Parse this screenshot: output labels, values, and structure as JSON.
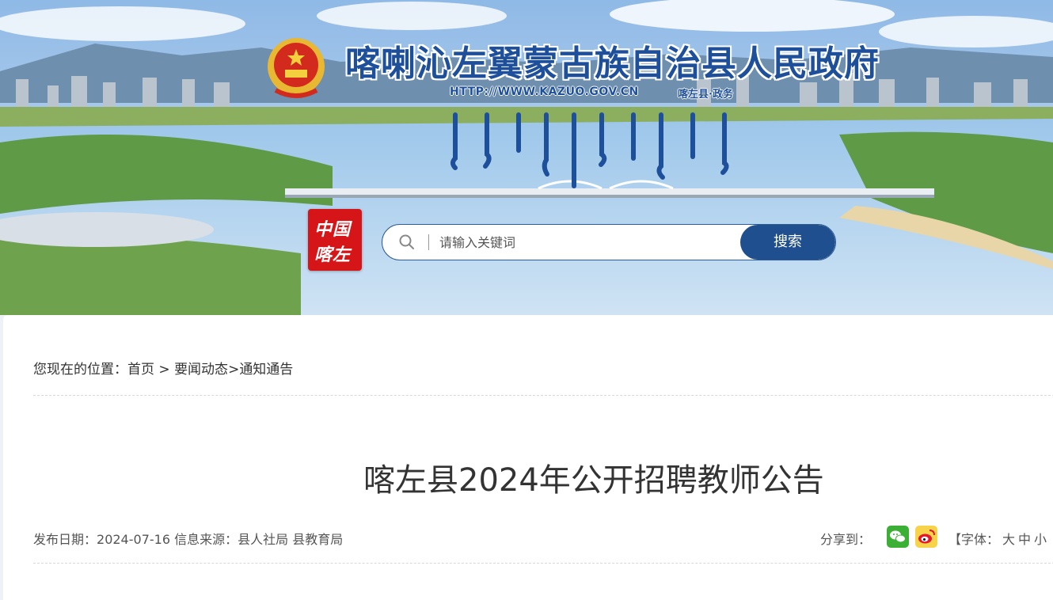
{
  "header": {
    "site_title": "喀喇沁左翼蒙古族自治县人民政府",
    "site_url": "HTTP://WWW.KAZUO.GOV.CN",
    "site_sub": "喀左县·政务",
    "logo_line1": "中国",
    "logo_line2": "喀左"
  },
  "search": {
    "placeholder": "请输入关键词",
    "button_label": "搜索"
  },
  "breadcrumb": {
    "prefix": "您现在的位置：",
    "home": "首页",
    "sep1": " > ",
    "section": "要闻动态",
    "sep2": ">",
    "current": "通知通告"
  },
  "article": {
    "title": "喀左县2024年公开招聘教师公告",
    "date_label": "发布日期：",
    "date": "2024-07-16",
    "source_label": "信息来源：",
    "source": "县人社局 县教育局"
  },
  "share": {
    "label": "分享到：",
    "icons": [
      "wechat-icon",
      "weibo-icon"
    ]
  },
  "font_size": {
    "prefix": "【字体：",
    "large": "大",
    "medium": "中",
    "small": "小"
  },
  "colors": {
    "brand_blue": "#1f4f8e",
    "logo_red": "#d61518"
  }
}
